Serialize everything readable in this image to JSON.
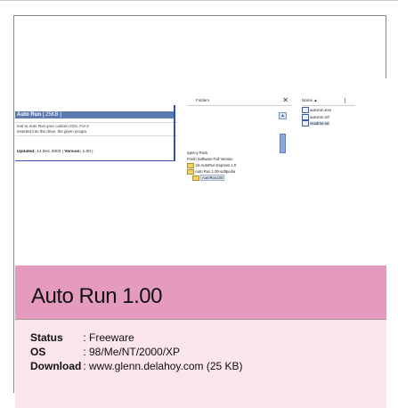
{
  "product_panel": {
    "name": "Auto Run",
    "size": "[ 25KB ]",
    "desc_line1": "tool to Auto Run your custom CDs. For e",
    "desc_line2": "inserted into the drive, the given progra",
    "updated_label": "Updated:",
    "updated_value": "14 Dec 2003",
    "separator": "|",
    "version_label": "Version:",
    "version_value": "1.00 |"
  },
  "folders_pane": {
    "title": "Folders",
    "close": "✕",
    "scroll_up": "▲",
    "tree": [
      "rgency Pack",
      "Fresh Software Full Version",
      "1st AutoRun Express 1.0",
      "Auto Run 1.00-softpedia",
      "AutoRun100"
    ]
  },
  "files_pane": {
    "column": "Name ▲",
    "files": [
      "autorun.exe",
      "autorun.inf",
      "readme.txt"
    ]
  },
  "title": "Auto Run 1.00",
  "details": [
    {
      "label": "Status",
      "value": ": Freeware"
    },
    {
      "label": "OS",
      "value": ": 98/Me/NT/2000/XP"
    },
    {
      "label": "Download",
      "value": ": www.glenn.delahoy.com (25 KB)"
    }
  ],
  "colors": {
    "band": "#e49bbd",
    "info_background": "#fbe5ec",
    "panel_bar": "#5a7bb0"
  }
}
